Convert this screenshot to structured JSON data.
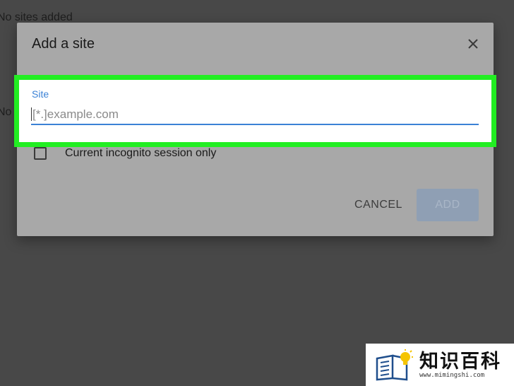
{
  "background": {
    "text_top": "No sites added",
    "text_mid": "No"
  },
  "dialog": {
    "title": "Add a site",
    "close_icon": "close-icon",
    "field": {
      "label": "Site",
      "placeholder": "[*.]example.com",
      "value": ""
    },
    "checkbox": {
      "label": "Current incognito session only",
      "checked": false
    },
    "buttons": {
      "cancel": "CANCEL",
      "add": "ADD"
    }
  },
  "highlight_color": "#22ee22",
  "accent_color": "#3b82d6",
  "watermark": {
    "brand": "知识百科",
    "url": "www.mimingshi.com"
  }
}
